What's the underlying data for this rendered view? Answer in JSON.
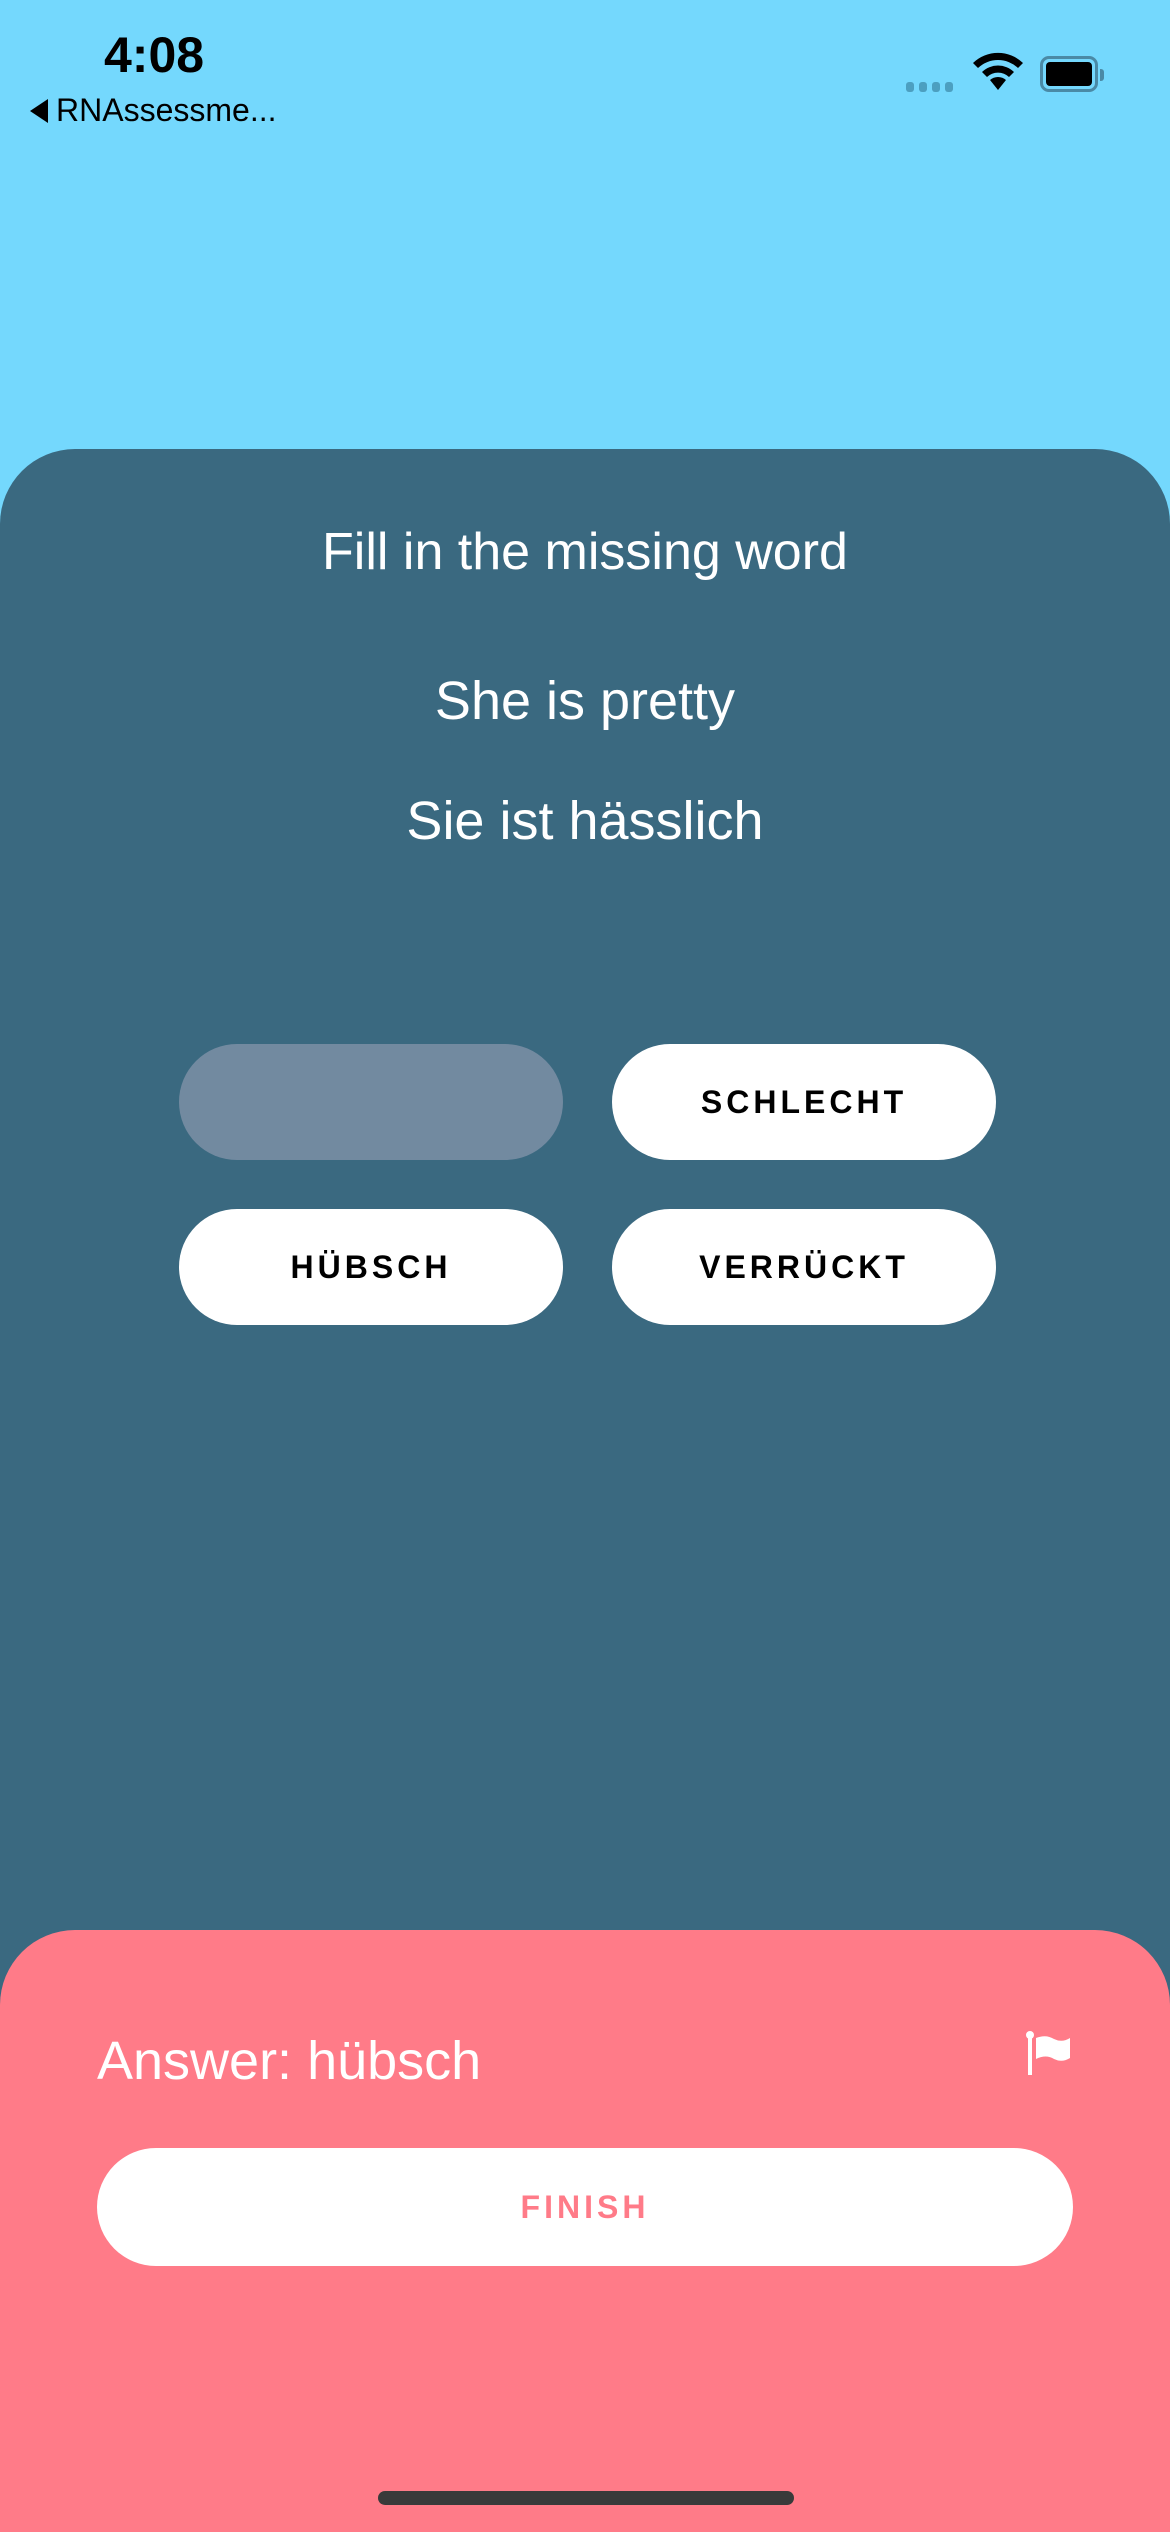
{
  "status_bar": {
    "time": "4:08",
    "back_label": "RNAssessme..."
  },
  "question": {
    "instruction": "Fill in the missing word",
    "source_sentence": "She is pretty",
    "target_sentence": "Sie ist hässlich"
  },
  "options": [
    "SCHLECHT",
    "HÜBSCH",
    "VERRÜCKT"
  ],
  "feedback": {
    "answer_text": "Answer: hübsch",
    "finish_label": "FINISH"
  },
  "colors": {
    "background": "#74d8fd",
    "card": "#3a6980",
    "panel": "#ff7b88",
    "slot": "#728aa0"
  }
}
